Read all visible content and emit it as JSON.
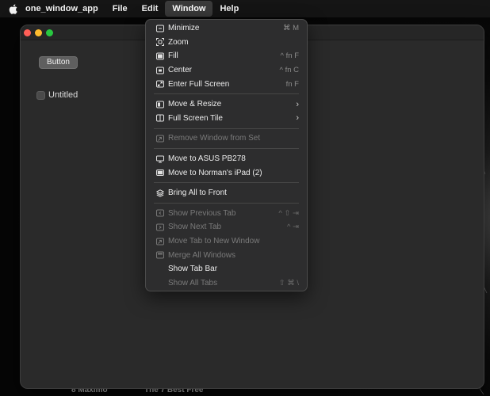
{
  "menubar": {
    "app_name": "one_window_app",
    "items": [
      "File",
      "Edit",
      "Window",
      "Help"
    ]
  },
  "window": {
    "button_label": "Button",
    "checkbox_label": "Untitled",
    "checkbox_checked": false
  },
  "window_menu": {
    "items": [
      {
        "label": "Minimize",
        "shortcut": "⌘ M",
        "icon": "minimize-icon",
        "enabled": true
      },
      {
        "label": "Zoom",
        "shortcut": "",
        "icon": "zoom-icon",
        "enabled": true
      },
      {
        "label": "Fill",
        "shortcut": "^ fn F",
        "icon": "fill-icon",
        "enabled": true
      },
      {
        "label": "Center",
        "shortcut": "^ fn C",
        "icon": "center-icon",
        "enabled": true
      },
      {
        "label": "Enter Full Screen",
        "shortcut": "fn F",
        "icon": "full-screen-icon",
        "enabled": true
      },
      {
        "label": "Move & Resize",
        "shortcut": "",
        "icon": "move-resize-icon",
        "enabled": true,
        "submenu": true
      },
      {
        "label": "Full Screen Tile",
        "shortcut": "",
        "icon": "tile-icon",
        "enabled": true,
        "submenu": true
      },
      {
        "label": "Remove Window from Set",
        "shortcut": "",
        "icon": "remove-window-icon",
        "enabled": false
      },
      {
        "label": "Move to ASUS PB278",
        "shortcut": "",
        "icon": "display-icon",
        "enabled": true
      },
      {
        "label": "Move to Norman's iPad (2)",
        "shortcut": "",
        "icon": "ipad-icon",
        "enabled": true
      },
      {
        "label": "Bring All to Front",
        "shortcut": "",
        "icon": "stack-icon",
        "enabled": true
      },
      {
        "label": "Show Previous Tab",
        "shortcut": "^ ⇧ ⇥",
        "icon": "previous-tab-icon",
        "enabled": false
      },
      {
        "label": "Show Next Tab",
        "shortcut": "^ ⇥",
        "icon": "next-tab-icon",
        "enabled": false
      },
      {
        "label": "Move Tab to New Window",
        "shortcut": "",
        "icon": "move-tab-icon",
        "enabled": false
      },
      {
        "label": "Merge All Windows",
        "shortcut": "",
        "icon": "merge-windows-icon",
        "enabled": false
      },
      {
        "label": "Show Tab Bar",
        "shortcut": "",
        "icon": "",
        "enabled": true
      },
      {
        "label": "Show All Tabs",
        "shortcut": "⇧ ⌘ \\",
        "icon": "",
        "enabled": false
      }
    ]
  },
  "desktop": {
    "bottom_text_left": "8 Maximo",
    "bottom_text_right": "The 7 Best Free"
  },
  "colors": {
    "traffic_close": "#ff5f57",
    "traffic_minimize": "#febc2e",
    "traffic_zoom": "#28c840",
    "menu_background": "#2d2d2e",
    "window_background": "#2a2a2a"
  }
}
